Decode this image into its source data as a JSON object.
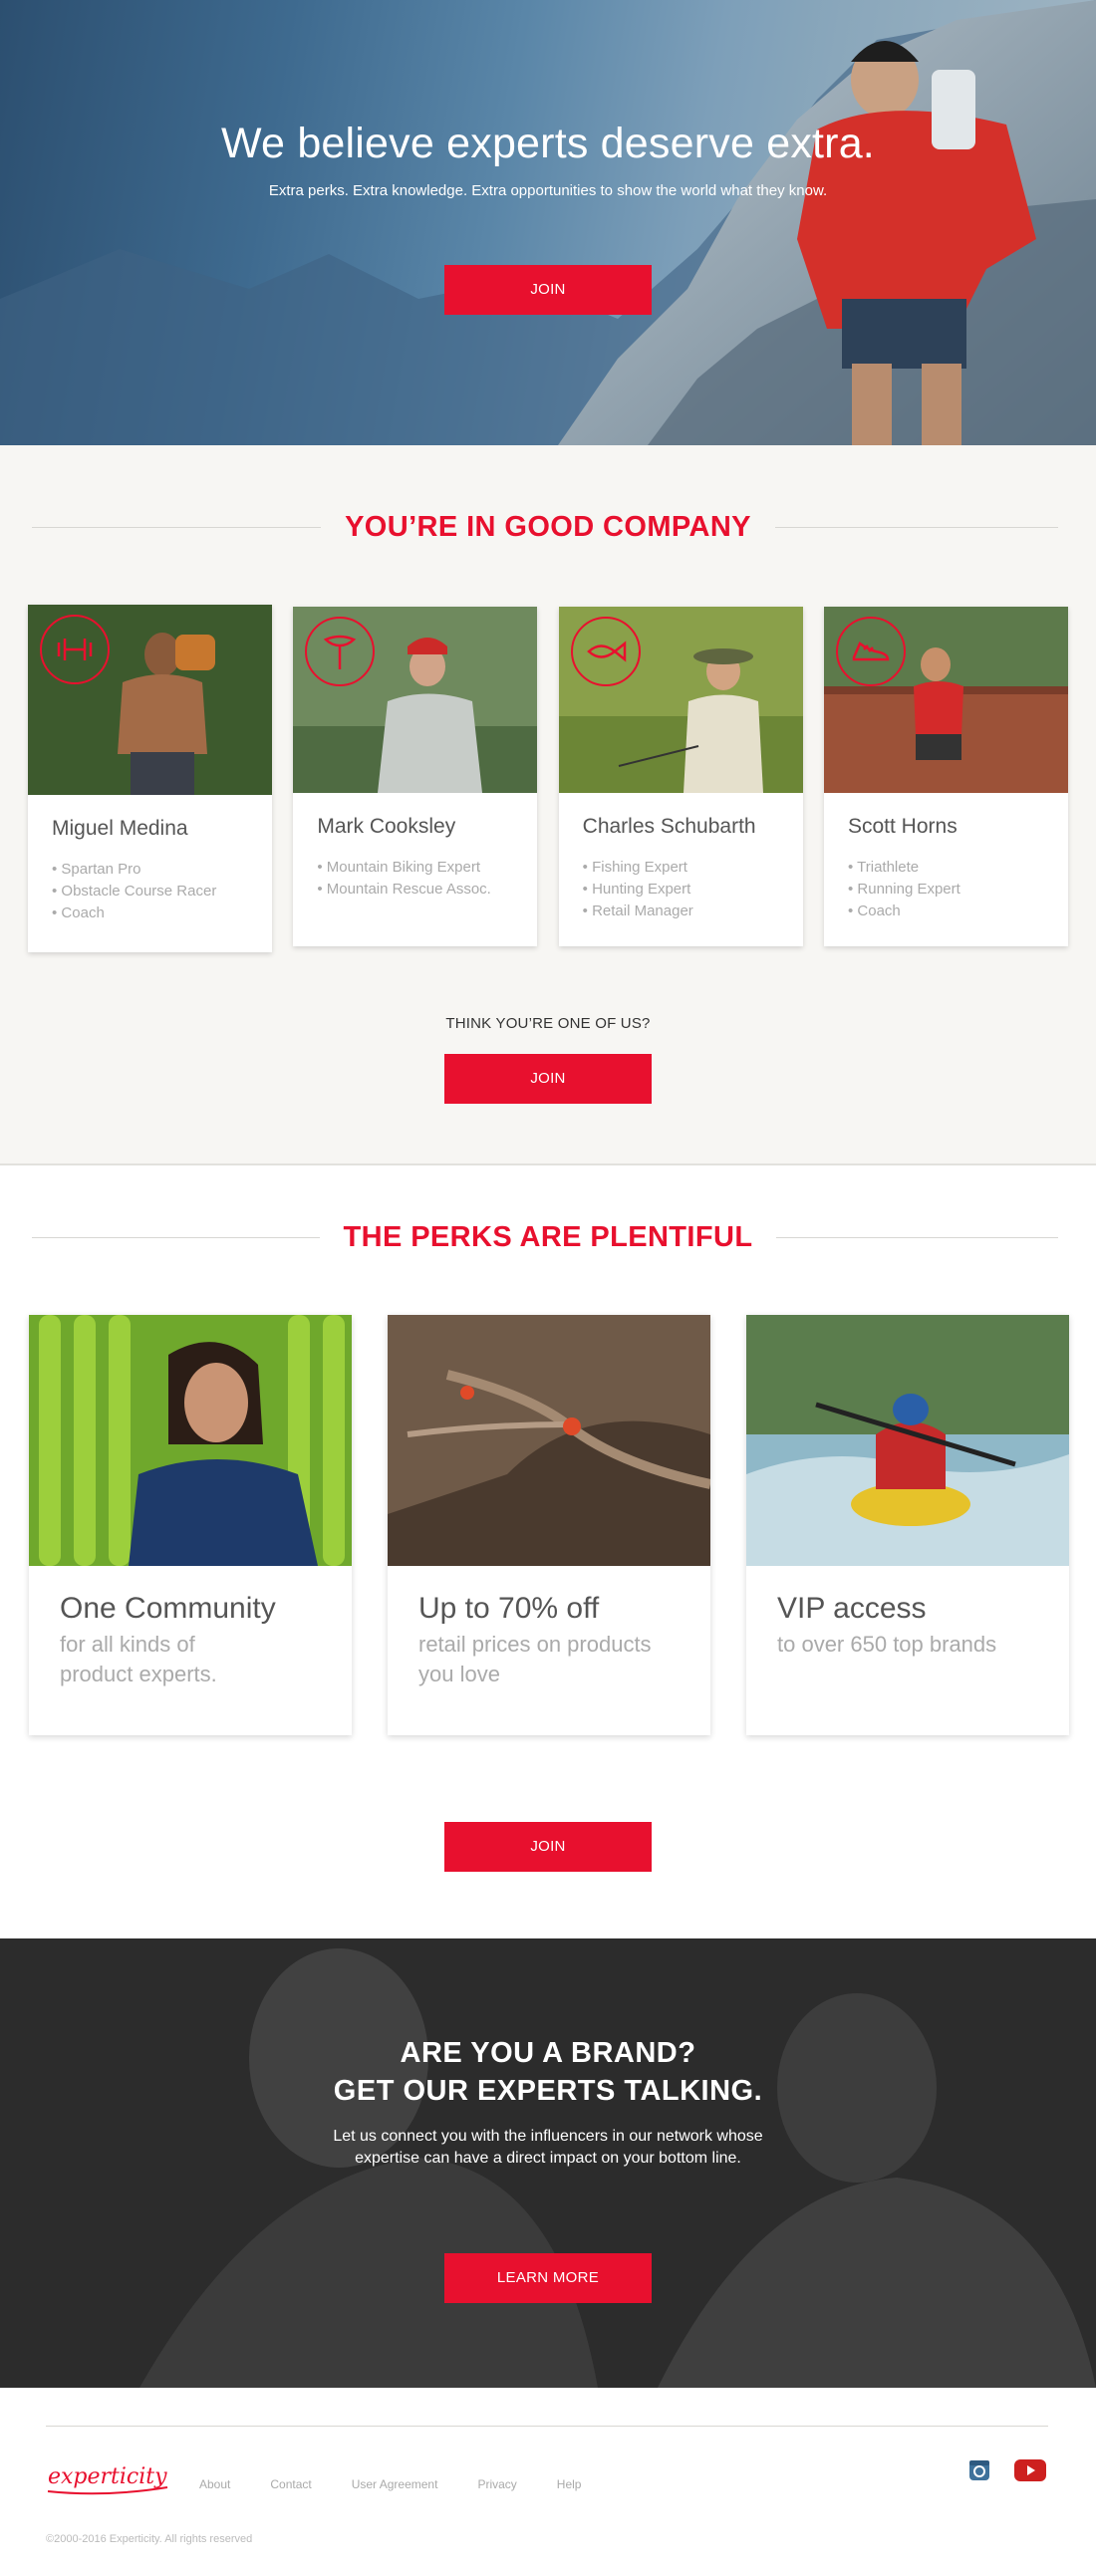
{
  "hero": {
    "title": "We believe experts deserve extra.",
    "subtitle": "Extra perks. Extra knowledge. Extra opportunities to show the world what they know.",
    "cta_label": "JOIN"
  },
  "company": {
    "heading": "YOU’RE IN GOOD COMPANY",
    "experts": [
      {
        "name": "Miguel Medina",
        "icon": "dumbbell-icon",
        "tags": [
          "Spartan Pro",
          "Obstacle Course Racer",
          "Coach"
        ]
      },
      {
        "name": "Mark Cooksley",
        "icon": "bike-seat-icon",
        "tags": [
          "Mountain Biking Expert",
          "Mountain Rescue Assoc."
        ]
      },
      {
        "name": "Charles Schubarth",
        "icon": "fish-icon",
        "tags": [
          "Fishing Expert",
          "Hunting Expert",
          "Retail Manager"
        ]
      },
      {
        "name": "Scott Horns",
        "icon": "running-shoe-icon",
        "tags": [
          "Triathlete",
          "Running Expert",
          "Coach"
        ]
      }
    ],
    "cta_prompt": "THINK YOU’RE ONE OF US?",
    "cta_label": "JOIN"
  },
  "perks": {
    "heading": "THE PERKS ARE PLENTIFUL",
    "cards": [
      {
        "title": "One Community",
        "description": "for all kinds of product experts."
      },
      {
        "title": "Up to 70% off",
        "description": "retail prices on products you love"
      },
      {
        "title": "VIP access",
        "description": "to over 650 top brands"
      }
    ],
    "cta_label": "JOIN"
  },
  "brand": {
    "title_line1": "ARE YOU A BRAND?",
    "title_line2": "GET OUR EXPERTS TALKING.",
    "description_line1": "Let us connect you with the influencers in our network whose",
    "description_line2": "expertise can have a direct impact on your bottom line.",
    "cta_label": "LEARN MORE"
  },
  "footer": {
    "logo_text": "experticity",
    "nav": [
      "About",
      "Contact",
      "User Agreement",
      "Privacy",
      "Help"
    ],
    "copyright": "©2000-2016 Experticity. All rights reserved"
  },
  "colors": {
    "accent": "#e8102e",
    "background_light": "#f7f6f3",
    "text_muted": "#aaaaaa",
    "instagram": "#3f729b",
    "youtube": "#cd201f"
  }
}
